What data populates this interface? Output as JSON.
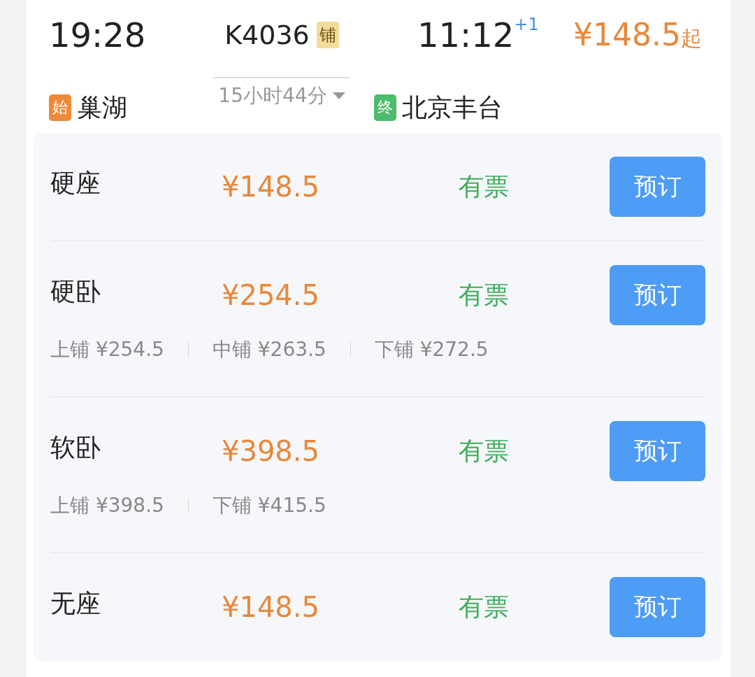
{
  "train": {
    "depart_time": "19:28",
    "depart_tag": "始",
    "depart_station": "巢湖",
    "number": "K4036",
    "type_badge": "铺",
    "duration": "15小时44分",
    "expanded": false,
    "arrive_time": "11:12",
    "day_offset": "+1",
    "arrive_tag": "终",
    "arrive_station": "北京丰台",
    "price": "¥148.5",
    "price_suffix": "起"
  },
  "seats": [
    {
      "name": "硬座",
      "price": "¥148.5",
      "availability": "有票",
      "button": "预订"
    },
    {
      "name": "硬卧",
      "price": "¥254.5",
      "availability": "有票",
      "button": "预订",
      "berths": [
        "上铺 ¥254.5",
        "中铺 ¥263.5",
        "下铺 ¥272.5"
      ]
    },
    {
      "name": "软卧",
      "price": "¥398.5",
      "availability": "有票",
      "button": "预订",
      "berths": [
        "上铺 ¥398.5",
        "下铺 ¥415.5"
      ]
    },
    {
      "name": "无座",
      "price": "¥148.5",
      "availability": "有票",
      "button": "预订"
    }
  ]
}
